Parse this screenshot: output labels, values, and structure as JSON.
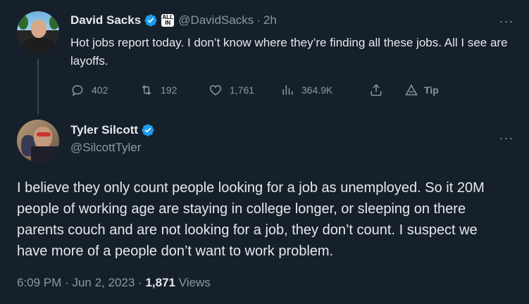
{
  "tweet1": {
    "author_name": "David Sacks",
    "affiliate_badge": [
      "ALL",
      "IN"
    ],
    "handle": "@DavidSacks",
    "separator": "·",
    "time": "2h",
    "more": "···",
    "text": "Hot jobs report today. I don’t know where they’re finding all these jobs. All I see are layoffs.",
    "actions": {
      "replies": "402",
      "reposts": "192",
      "likes": "1,761",
      "views": "364.9K",
      "tip_label": "Tip"
    }
  },
  "tweet2": {
    "author_name": "Tyler Silcott",
    "handle": "@SilcottTyler",
    "more": "···",
    "text": "I believe they only count people looking for a job as unemployed. So it 20M people of working age are staying in college longer, or sleeping on there parents couch and are not looking for a job, they don’t count. I suspect we have more of a people don’t want to work problem.",
    "time": "6:09 PM",
    "sep1": "·",
    "date": "Jun 2, 2023",
    "sep2": "·",
    "views_count": "1,871",
    "views_label": "Views"
  },
  "colors": {
    "background": "#15202b",
    "text": "#e7e9ea",
    "secondary": "#8b98a5",
    "verified": "#1d9bf0"
  },
  "icons": [
    "reply-icon",
    "retweet-icon",
    "like-icon",
    "views-icon",
    "share-icon",
    "tip-icon",
    "verified-icon",
    "more-icon"
  ]
}
